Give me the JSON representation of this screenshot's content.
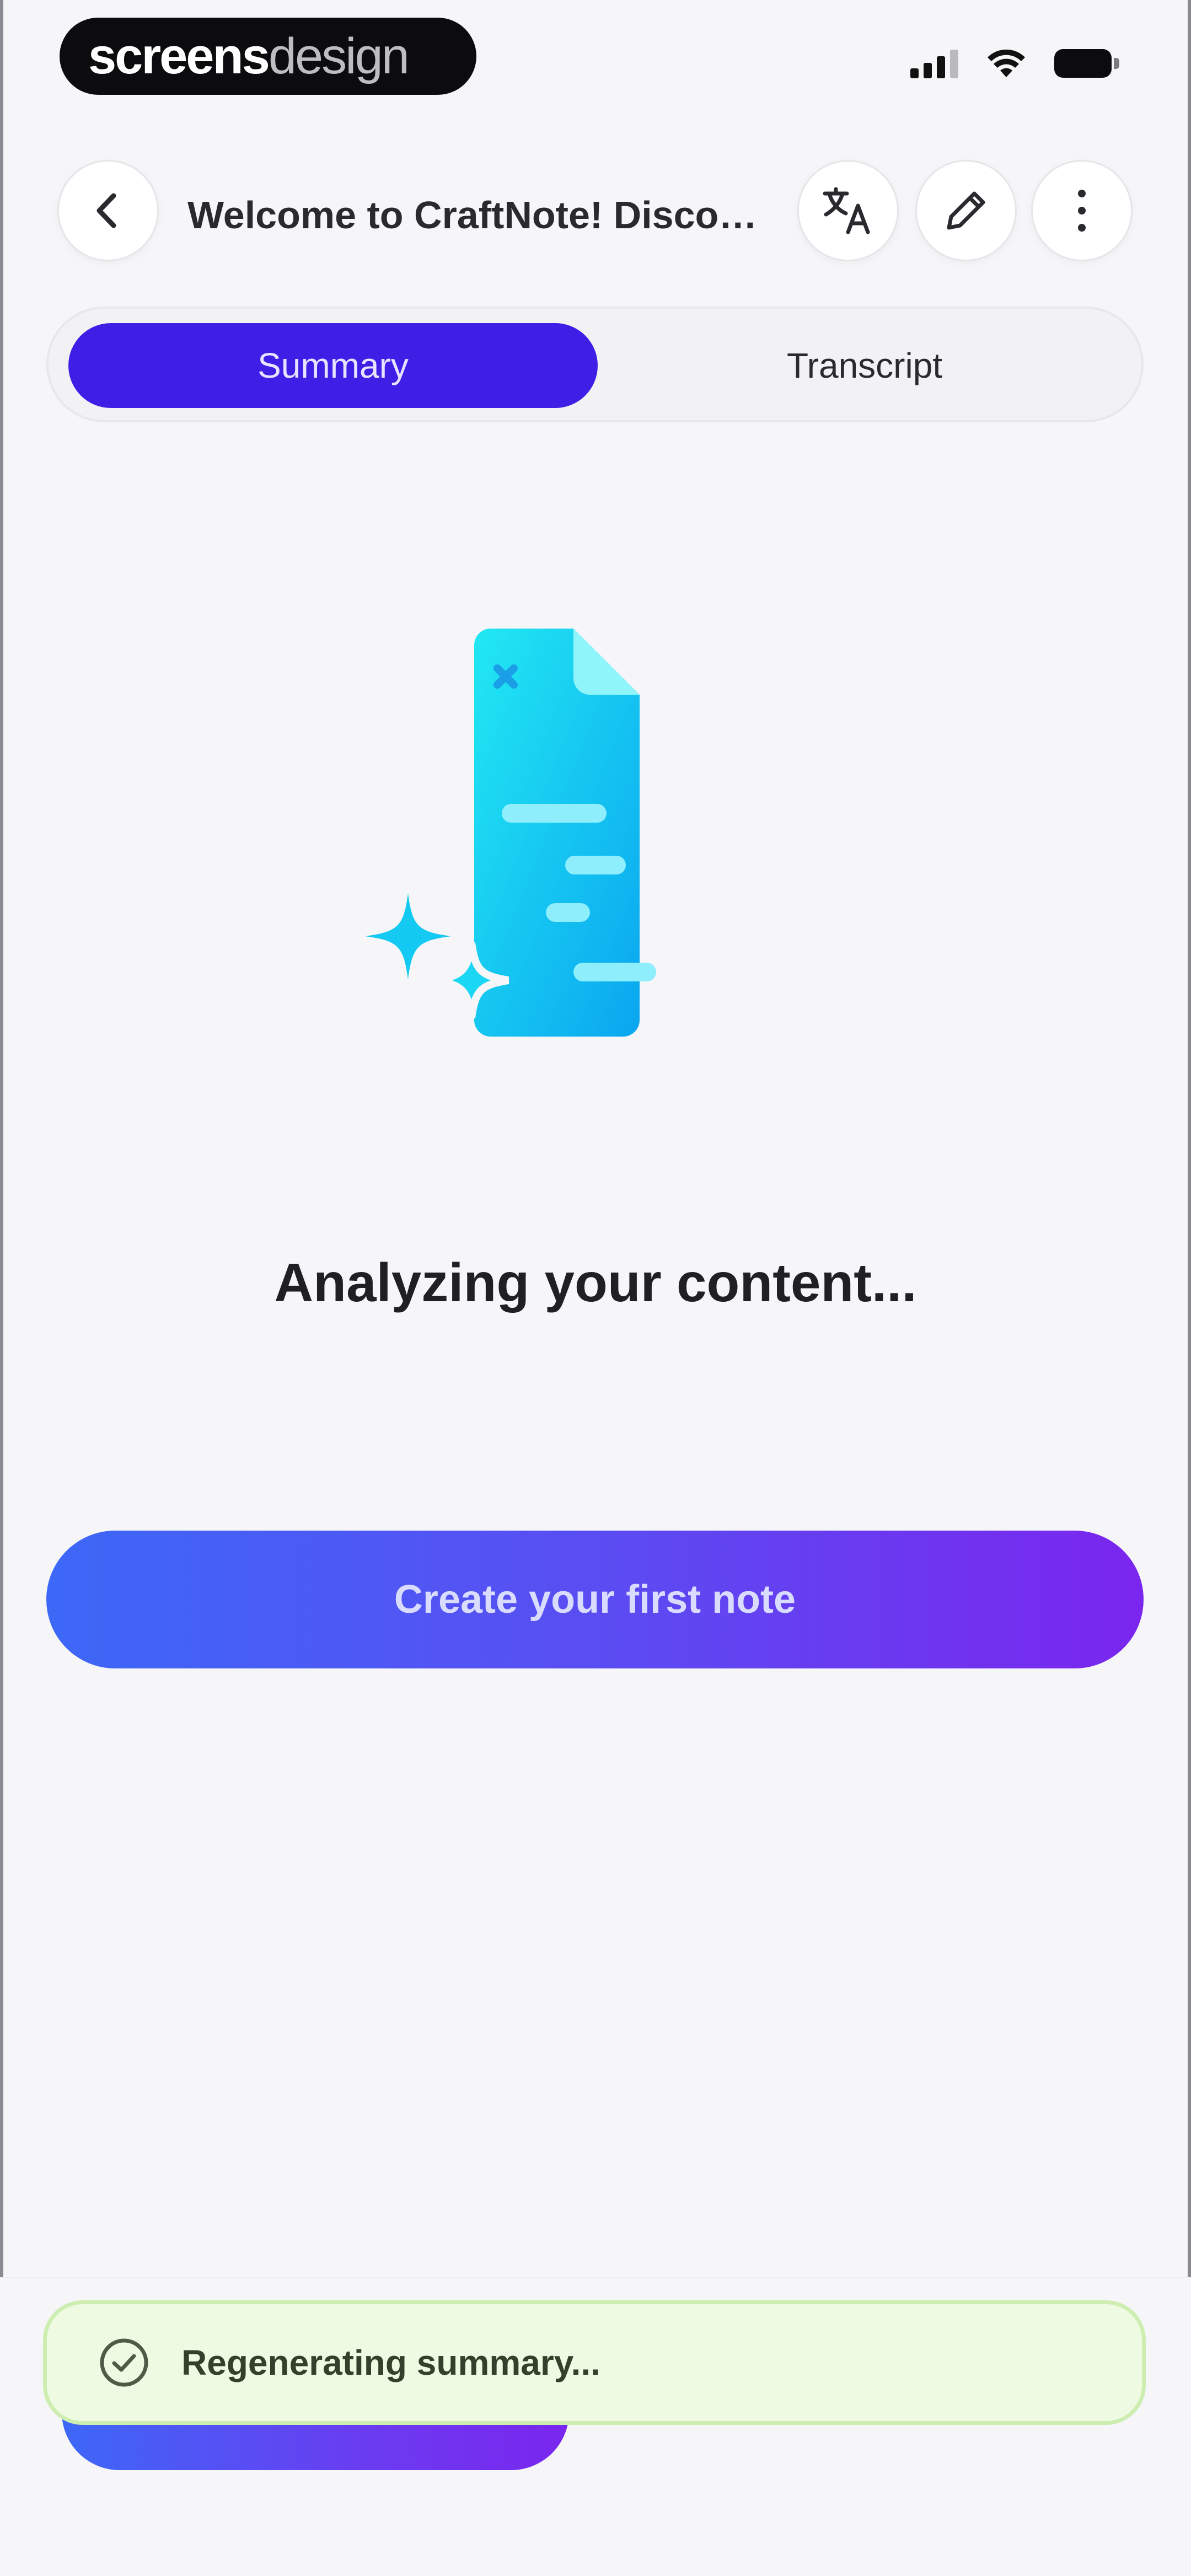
{
  "status_bar": {
    "brand_bold": "screens",
    "brand_light": "design",
    "icons": [
      "cellular-signal-icon",
      "wifi-icon",
      "battery-icon"
    ]
  },
  "header": {
    "title": "Welcome to CraftNote! Discov...",
    "icons": [
      "chevron-left-icon",
      "translate-icon",
      "pencil-icon",
      "more-vertical-icon"
    ]
  },
  "tabs": [
    {
      "label": "Summary",
      "active": true
    },
    {
      "label": "Transcript",
      "active": false
    }
  ],
  "main": {
    "illustration": "document-sparkles-icon",
    "status": "Analyzing your content...",
    "cta_label": "Create your first note"
  },
  "toast": {
    "text": "Regenerating summary...",
    "icon": "check-circle-icon"
  },
  "colors": {
    "background": "#f6f6f8",
    "tab_active": "#3f1fe6",
    "cta_gradient_start": "#3d68f7",
    "cta_gradient_end": "#7a26ee",
    "illustration": "#1fd4f0",
    "toast_bg": "#eefbe2",
    "toast_border": "#cdeeb0"
  }
}
